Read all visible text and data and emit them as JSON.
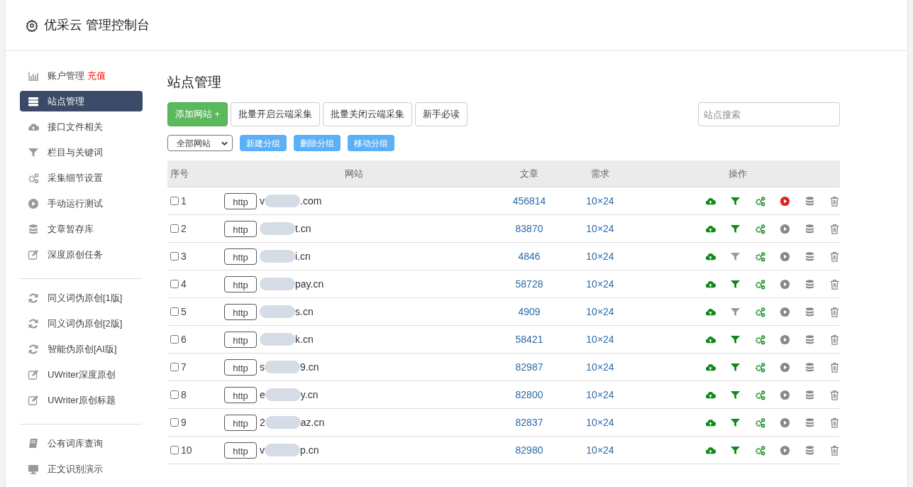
{
  "header": {
    "title": "优采云 管理控制台"
  },
  "sidebar": {
    "groups": [
      [
        {
          "label": "账户管理",
          "badge": "充值",
          "selected": false
        },
        {
          "label": "站点管理",
          "selected": true
        },
        {
          "label": "接口文件相关",
          "selected": false
        },
        {
          "label": "栏目与关键词",
          "selected": false
        },
        {
          "label": "采集细节设置",
          "selected": false
        },
        {
          "label": "手动运行测试",
          "selected": false
        },
        {
          "label": "文章暂存库",
          "selected": false
        },
        {
          "label": "深度原创任务",
          "selected": false
        }
      ],
      [
        {
          "label": "同义词伪原创[1版]",
          "selected": false
        },
        {
          "label": "同义词伪原创[2版]",
          "selected": false
        },
        {
          "label": "智能伪原创[AI版]",
          "selected": false
        },
        {
          "label": "UWriter深度原创",
          "selected": false
        },
        {
          "label": "UWriter原创标题",
          "selected": false
        }
      ],
      [
        {
          "label": "公有词库查询",
          "selected": false
        },
        {
          "label": "正文识别演示",
          "selected": false
        }
      ]
    ]
  },
  "main": {
    "title": "站点管理",
    "buttons": [
      {
        "kind": "primary",
        "label": "添加网站 +"
      },
      {
        "kind": "default",
        "label": "批量开启云端采集"
      },
      {
        "kind": "default",
        "label": "批量关闭云端采集"
      },
      {
        "kind": "default",
        "label": "新手必读"
      }
    ],
    "search": {
      "placeholder": "站点搜索"
    },
    "group_select": "全部网站",
    "group_buttons": [
      "新建分组",
      "删除分组",
      "移动分组"
    ],
    "table": {
      "columns": [
        "序号",
        "网站",
        "文章",
        "需求",
        "操作"
      ],
      "rows": [
        {
          "no": "1",
          "checked": false,
          "protocol": "http",
          "site_prefix": "v",
          "site_suffix": ".com",
          "articles": "456814",
          "demand": "10×24",
          "filter_on": true,
          "running": true
        },
        {
          "no": "2",
          "checked": false,
          "protocol": "http",
          "site_suffix": "t.cn",
          "articles": "83870",
          "demand": "10×24",
          "filter_on": true,
          "running": false
        },
        {
          "no": "3",
          "checked": false,
          "protocol": "http",
          "site_suffix": "i.cn",
          "articles": "4846",
          "demand": "10×24",
          "filter_on": false,
          "running": false
        },
        {
          "no": "4",
          "checked": false,
          "protocol": "http",
          "site_suffix": "pay.cn",
          "articles": "58728",
          "demand": "10×24",
          "filter_on": true,
          "running": false
        },
        {
          "no": "5",
          "checked": false,
          "protocol": "http",
          "site_suffix": "s.cn",
          "articles": "4909",
          "demand": "10×24",
          "filter_on": false,
          "running": false
        },
        {
          "no": "6",
          "checked": false,
          "protocol": "http",
          "site_suffix": "k.cn",
          "articles": "58421",
          "demand": "10×24",
          "filter_on": true,
          "running": false
        },
        {
          "no": "7",
          "checked": false,
          "protocol": "http",
          "site_prefix": "s",
          "site_suffix": "9.cn",
          "articles": "82987",
          "demand": "10×24",
          "filter_on": true,
          "running": false
        },
        {
          "no": "8",
          "checked": false,
          "protocol": "http",
          "site_prefix": "e",
          "site_suffix": "y.cn",
          "articles": "82800",
          "demand": "10×24",
          "filter_on": true,
          "running": false
        },
        {
          "no": "9",
          "checked": false,
          "protocol": "http",
          "site_prefix": "2",
          "site_suffix": "az.cn",
          "articles": "82837",
          "demand": "10×24",
          "filter_on": true,
          "running": false
        },
        {
          "no": "10",
          "checked": false,
          "protocol": "http",
          "site_prefix": "v",
          "site_suffix": "p.cn",
          "articles": "82980",
          "demand": "10×24",
          "filter_on": true,
          "running": false
        }
      ]
    }
  }
}
